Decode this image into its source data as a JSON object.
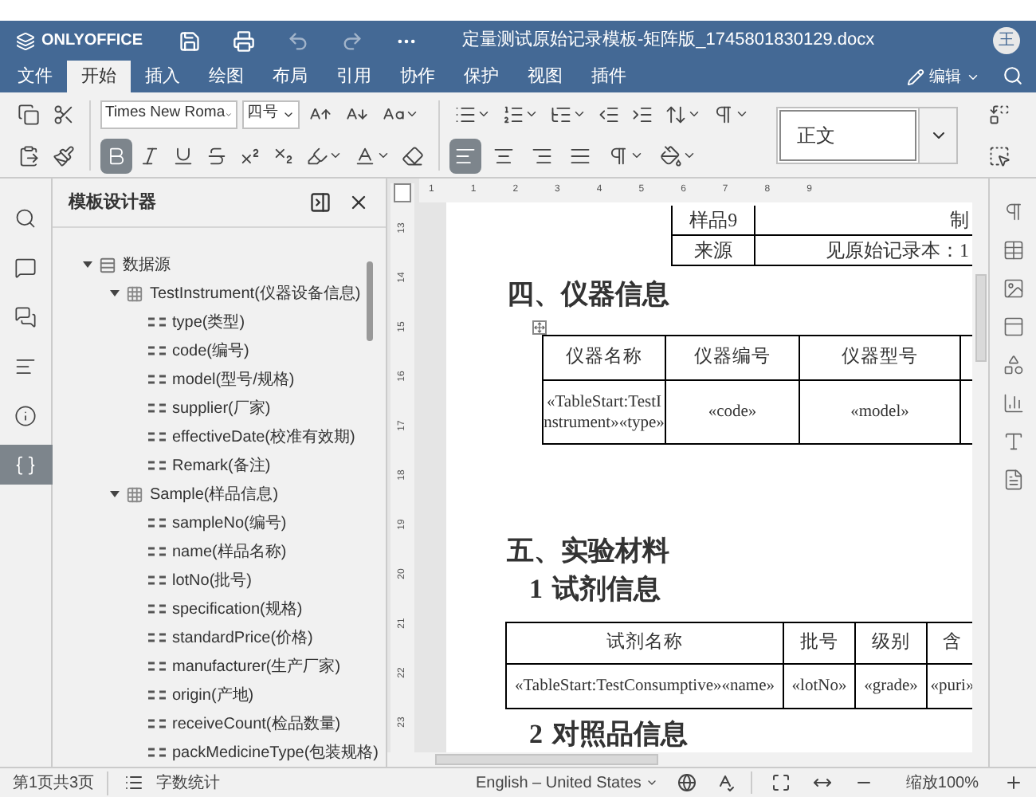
{
  "window": {
    "app_name": "ONLYOFFICE",
    "title": "定量测试原始记录模板-矩阵版_1745801830129.docx",
    "avatar": "王"
  },
  "menu_tabs": [
    {
      "label": "文件",
      "selected": false
    },
    {
      "label": "开始",
      "selected": true
    },
    {
      "label": "插入",
      "selected": false
    },
    {
      "label": "绘图",
      "selected": false
    },
    {
      "label": "布局",
      "selected": false
    },
    {
      "label": "引用",
      "selected": false
    },
    {
      "label": "协作",
      "selected": false
    },
    {
      "label": "保护",
      "selected": false
    },
    {
      "label": "视图",
      "selected": false
    },
    {
      "label": "插件",
      "selected": false
    }
  ],
  "edit_mode": "编辑",
  "toolbar": {
    "font": "Times New Roma",
    "font_size": "四号",
    "style": "正文",
    "format_buttons": [
      {
        "kind": "bold",
        "active": true
      },
      {
        "kind": "italic",
        "active": false
      },
      {
        "kind": "underline",
        "active": false
      },
      {
        "kind": "strikethrough",
        "active": false
      },
      {
        "kind": "superscript",
        "active": false
      },
      {
        "kind": "subscript",
        "active": false
      }
    ],
    "align_buttons": [
      {
        "kind": "left",
        "active": true
      },
      {
        "kind": "center",
        "active": false
      },
      {
        "kind": "right",
        "active": false
      },
      {
        "kind": "justify",
        "active": false
      }
    ]
  },
  "left_rail": [
    {
      "kind": "search",
      "selected": false
    },
    {
      "kind": "comments",
      "selected": false
    },
    {
      "kind": "chat",
      "selected": false
    },
    {
      "kind": "headings",
      "selected": false
    },
    {
      "kind": "info",
      "selected": false
    },
    {
      "kind": "braces",
      "selected": true
    }
  ],
  "panel": {
    "title": "模板设计器",
    "tree": [
      {
        "label": "数据源",
        "kind": "source",
        "expanded": true,
        "children": [
          {
            "label": "TestInstrument(仪器设备信息)",
            "kind": "table",
            "expanded": true,
            "children": [
              {
                "label": "type(类型)",
                "kind": "field"
              },
              {
                "label": "code(编号)",
                "kind": "field"
              },
              {
                "label": "model(型号/规格)",
                "kind": "field"
              },
              {
                "label": "supplier(厂家)",
                "kind": "field"
              },
              {
                "label": "effectiveDate(校准有效期)",
                "kind": "field"
              },
              {
                "label": "Remark(备注)",
                "kind": "field"
              }
            ]
          },
          {
            "label": "Sample(样品信息)",
            "kind": "table",
            "expanded": true,
            "children": [
              {
                "label": "sampleNo(编号)",
                "kind": "field"
              },
              {
                "label": "name(样品名称)",
                "kind": "field"
              },
              {
                "label": "lotNo(批号)",
                "kind": "field"
              },
              {
                "label": "specification(规格)",
                "kind": "field"
              },
              {
                "label": "standardPrice(价格)",
                "kind": "field"
              },
              {
                "label": "manufacturer(生产厂家)",
                "kind": "field"
              },
              {
                "label": "origin(产地)",
                "kind": "field"
              },
              {
                "label": "receiveCount(检品数量)",
                "kind": "field"
              },
              {
                "label": "packMedicineType(包装规格)",
                "kind": "field"
              }
            ]
          }
        ]
      }
    ]
  },
  "ruler": {
    "horizontal": [
      "1",
      "1",
      "2",
      "3",
      "4",
      "5",
      "6",
      "7",
      "8",
      "9"
    ],
    "vertical": [
      "13",
      "14",
      "15",
      "16",
      "17",
      "18",
      "19",
      "20",
      "21",
      "22",
      "23"
    ]
  },
  "document": [
    {
      "kind": "partial_table",
      "rows": [
        [
          "样品9",
          "制"
        ],
        [
          "来源",
          "见原始记录本：1"
        ]
      ]
    },
    {
      "kind": "heading",
      "text": "四、仪器信息"
    },
    {
      "kind": "table",
      "header": [
        "仪器名称",
        "仪器编号",
        "仪器型号"
      ],
      "rows": [
        [
          "«TableStart:TestInstrument»«type»",
          "«code»",
          "«model»"
        ]
      ]
    },
    {
      "kind": "heading",
      "text": "五、实验材料"
    },
    {
      "kind": "subheading",
      "number": "1",
      "text": "试剂信息"
    },
    {
      "kind": "table",
      "header": [
        "试剂名称",
        "批号",
        "级别",
        "含"
      ],
      "rows": [
        [
          "«TableStart:TestConsumptive»«name»",
          "«lotNo»",
          "«grade»",
          "«puri»"
        ]
      ]
    },
    {
      "kind": "subheading",
      "number": "2",
      "text": "对照品信息"
    }
  ],
  "right_rail": [
    {
      "kind": "paragraph"
    },
    {
      "kind": "table"
    },
    {
      "kind": "image"
    },
    {
      "kind": "header"
    },
    {
      "kind": "shape"
    },
    {
      "kind": "chart"
    },
    {
      "kind": "textart"
    },
    {
      "kind": "mailmerge"
    }
  ],
  "status_bar": {
    "page": "第1页共3页",
    "word_count": "字数统计",
    "language": "English – United States",
    "zoom": "缩放100%"
  }
}
